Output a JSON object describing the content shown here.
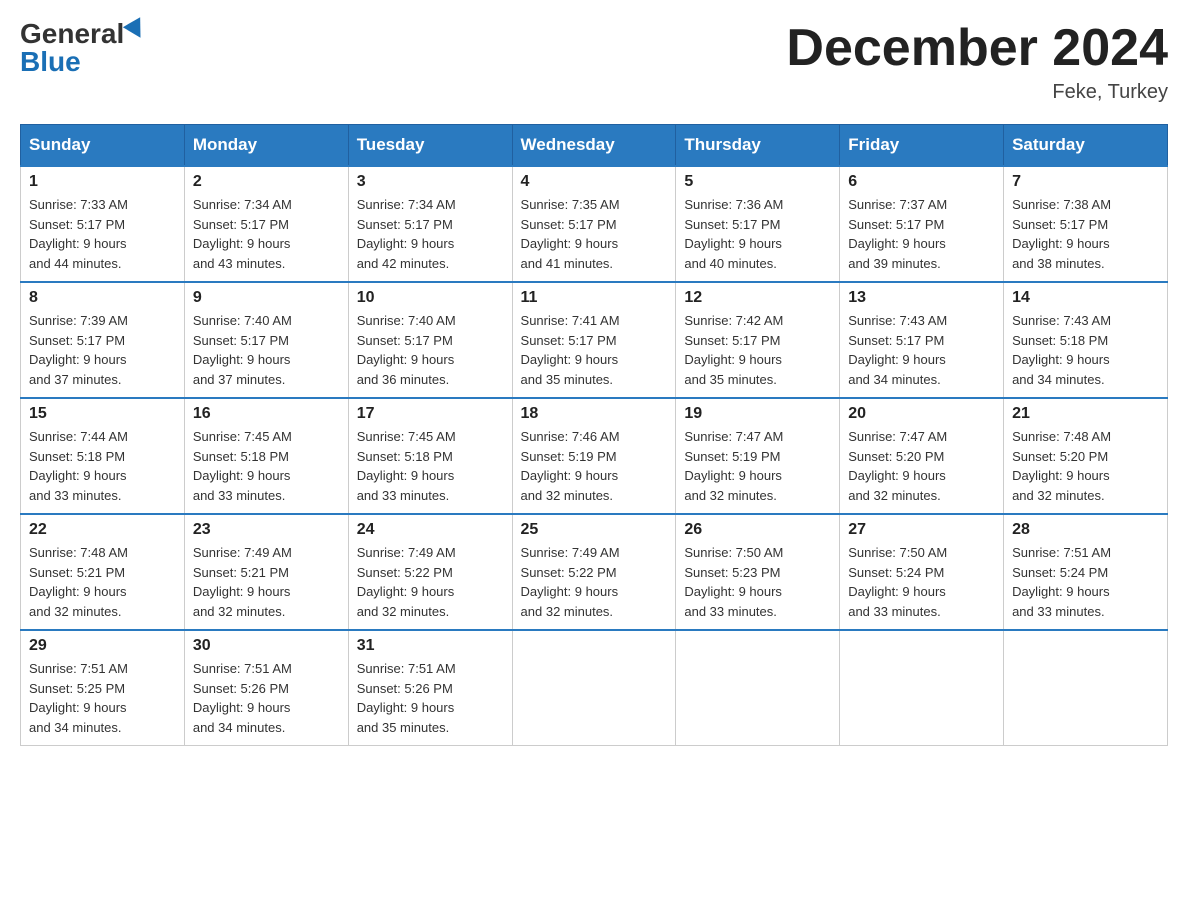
{
  "header": {
    "title": "December 2024",
    "location": "Feke, Turkey",
    "logo_general": "General",
    "logo_blue": "Blue"
  },
  "columns": [
    "Sunday",
    "Monday",
    "Tuesday",
    "Wednesday",
    "Thursday",
    "Friday",
    "Saturday"
  ],
  "weeks": [
    [
      {
        "day": "1",
        "sunrise": "7:33 AM",
        "sunset": "5:17 PM",
        "daylight": "9 hours and 44 minutes."
      },
      {
        "day": "2",
        "sunrise": "7:34 AM",
        "sunset": "5:17 PM",
        "daylight": "9 hours and 43 minutes."
      },
      {
        "day": "3",
        "sunrise": "7:34 AM",
        "sunset": "5:17 PM",
        "daylight": "9 hours and 42 minutes."
      },
      {
        "day": "4",
        "sunrise": "7:35 AM",
        "sunset": "5:17 PM",
        "daylight": "9 hours and 41 minutes."
      },
      {
        "day": "5",
        "sunrise": "7:36 AM",
        "sunset": "5:17 PM",
        "daylight": "9 hours and 40 minutes."
      },
      {
        "day": "6",
        "sunrise": "7:37 AM",
        "sunset": "5:17 PM",
        "daylight": "9 hours and 39 minutes."
      },
      {
        "day": "7",
        "sunrise": "7:38 AM",
        "sunset": "5:17 PM",
        "daylight": "9 hours and 38 minutes."
      }
    ],
    [
      {
        "day": "8",
        "sunrise": "7:39 AM",
        "sunset": "5:17 PM",
        "daylight": "9 hours and 37 minutes."
      },
      {
        "day": "9",
        "sunrise": "7:40 AM",
        "sunset": "5:17 PM",
        "daylight": "9 hours and 37 minutes."
      },
      {
        "day": "10",
        "sunrise": "7:40 AM",
        "sunset": "5:17 PM",
        "daylight": "9 hours and 36 minutes."
      },
      {
        "day": "11",
        "sunrise": "7:41 AM",
        "sunset": "5:17 PM",
        "daylight": "9 hours and 35 minutes."
      },
      {
        "day": "12",
        "sunrise": "7:42 AM",
        "sunset": "5:17 PM",
        "daylight": "9 hours and 35 minutes."
      },
      {
        "day": "13",
        "sunrise": "7:43 AM",
        "sunset": "5:17 PM",
        "daylight": "9 hours and 34 minutes."
      },
      {
        "day": "14",
        "sunrise": "7:43 AM",
        "sunset": "5:18 PM",
        "daylight": "9 hours and 34 minutes."
      }
    ],
    [
      {
        "day": "15",
        "sunrise": "7:44 AM",
        "sunset": "5:18 PM",
        "daylight": "9 hours and 33 minutes."
      },
      {
        "day": "16",
        "sunrise": "7:45 AM",
        "sunset": "5:18 PM",
        "daylight": "9 hours and 33 minutes."
      },
      {
        "day": "17",
        "sunrise": "7:45 AM",
        "sunset": "5:18 PM",
        "daylight": "9 hours and 33 minutes."
      },
      {
        "day": "18",
        "sunrise": "7:46 AM",
        "sunset": "5:19 PM",
        "daylight": "9 hours and 32 minutes."
      },
      {
        "day": "19",
        "sunrise": "7:47 AM",
        "sunset": "5:19 PM",
        "daylight": "9 hours and 32 minutes."
      },
      {
        "day": "20",
        "sunrise": "7:47 AM",
        "sunset": "5:20 PM",
        "daylight": "9 hours and 32 minutes."
      },
      {
        "day": "21",
        "sunrise": "7:48 AM",
        "sunset": "5:20 PM",
        "daylight": "9 hours and 32 minutes."
      }
    ],
    [
      {
        "day": "22",
        "sunrise": "7:48 AM",
        "sunset": "5:21 PM",
        "daylight": "9 hours and 32 minutes."
      },
      {
        "day": "23",
        "sunrise": "7:49 AM",
        "sunset": "5:21 PM",
        "daylight": "9 hours and 32 minutes."
      },
      {
        "day": "24",
        "sunrise": "7:49 AM",
        "sunset": "5:22 PM",
        "daylight": "9 hours and 32 minutes."
      },
      {
        "day": "25",
        "sunrise": "7:49 AM",
        "sunset": "5:22 PM",
        "daylight": "9 hours and 32 minutes."
      },
      {
        "day": "26",
        "sunrise": "7:50 AM",
        "sunset": "5:23 PM",
        "daylight": "9 hours and 33 minutes."
      },
      {
        "day": "27",
        "sunrise": "7:50 AM",
        "sunset": "5:24 PM",
        "daylight": "9 hours and 33 minutes."
      },
      {
        "day": "28",
        "sunrise": "7:51 AM",
        "sunset": "5:24 PM",
        "daylight": "9 hours and 33 minutes."
      }
    ],
    [
      {
        "day": "29",
        "sunrise": "7:51 AM",
        "sunset": "5:25 PM",
        "daylight": "9 hours and 34 minutes."
      },
      {
        "day": "30",
        "sunrise": "7:51 AM",
        "sunset": "5:26 PM",
        "daylight": "9 hours and 34 minutes."
      },
      {
        "day": "31",
        "sunrise": "7:51 AM",
        "sunset": "5:26 PM",
        "daylight": "9 hours and 35 minutes."
      },
      null,
      null,
      null,
      null
    ]
  ],
  "labels": {
    "sunrise": "Sunrise:",
    "sunset": "Sunset:",
    "daylight": "Daylight:"
  }
}
